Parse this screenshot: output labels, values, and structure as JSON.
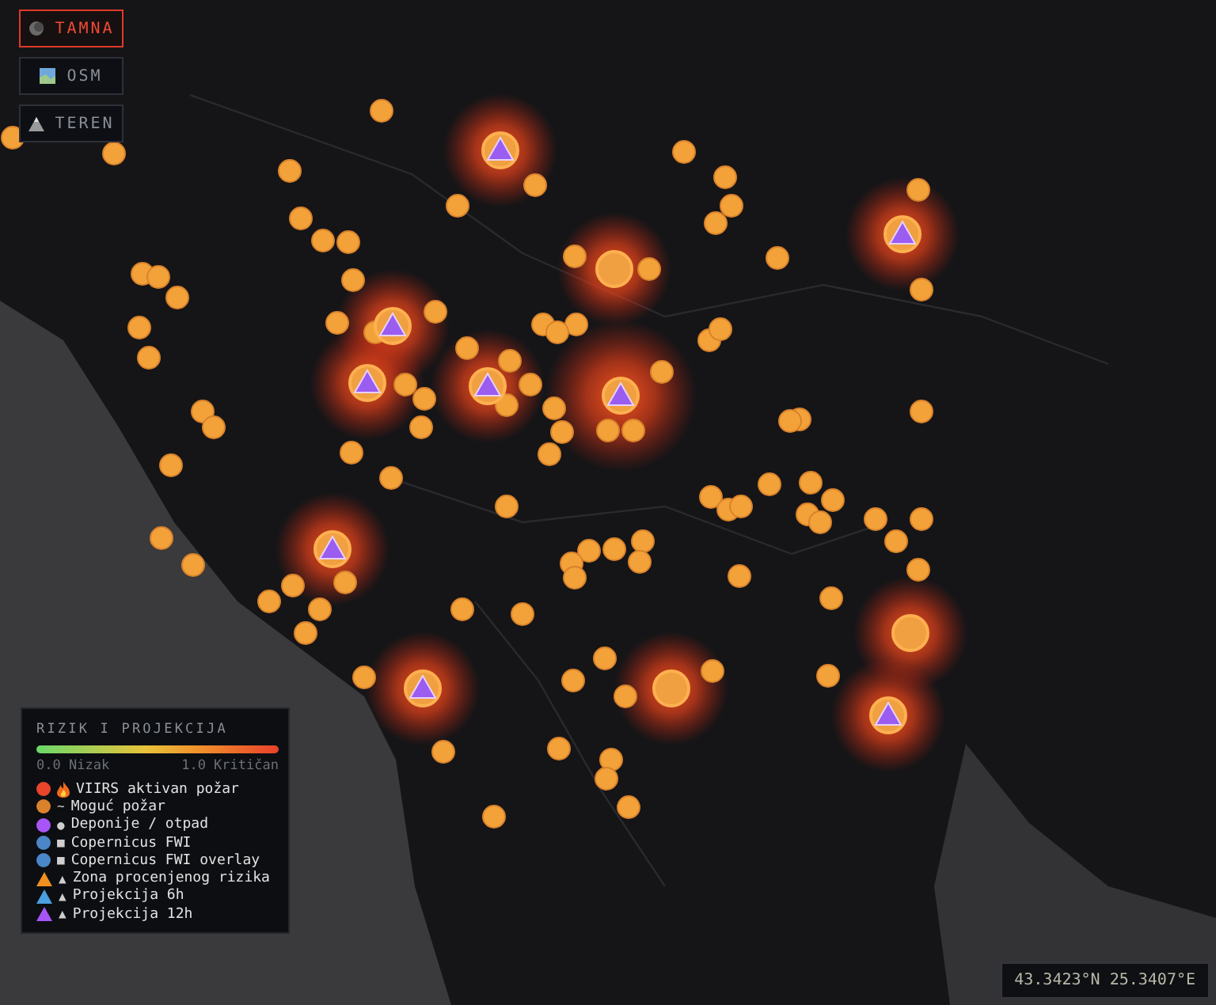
{
  "layer_buttons": [
    {
      "label": "TAMNA",
      "selected": true
    },
    {
      "label": "OSM",
      "selected": false
    },
    {
      "label": "TEREN",
      "selected": false
    }
  ],
  "legend": {
    "title": "RIZIK I PROJEKCIJA",
    "scale_min": "0.0 Nizak",
    "scale_max": "1.0 Kritičan",
    "items": [
      {
        "kind": "dot",
        "color": "#e8452c",
        "label": "VIIRS aktivan požar"
      },
      {
        "kind": "dot",
        "color": "#d9822b",
        "symbol": "~",
        "label": "Moguć požar"
      },
      {
        "kind": "dot",
        "color": "#a855f7",
        "symbol": "●",
        "label": "Deponije / otpad"
      },
      {
        "kind": "dot",
        "color": "#4a86c8",
        "symbol": "■",
        "label": "Copernicus FWI"
      },
      {
        "kind": "dot",
        "color": "#4a86c8",
        "symbol": "■",
        "label": "Copernicus FWI overlay"
      },
      {
        "kind": "triangle",
        "color": "#f0901e",
        "symbol": "▲",
        "label": "Zona procenjenog rizika"
      },
      {
        "kind": "triangle",
        "color": "#4aa0e0",
        "symbol": "▲",
        "label": "Projekcija 6h"
      },
      {
        "kind": "triangle",
        "color": "#a855f7",
        "symbol": "▲",
        "label": "Projekcija 12h"
      }
    ]
  },
  "coordinates": "43.3423°N 25.3407°E"
}
